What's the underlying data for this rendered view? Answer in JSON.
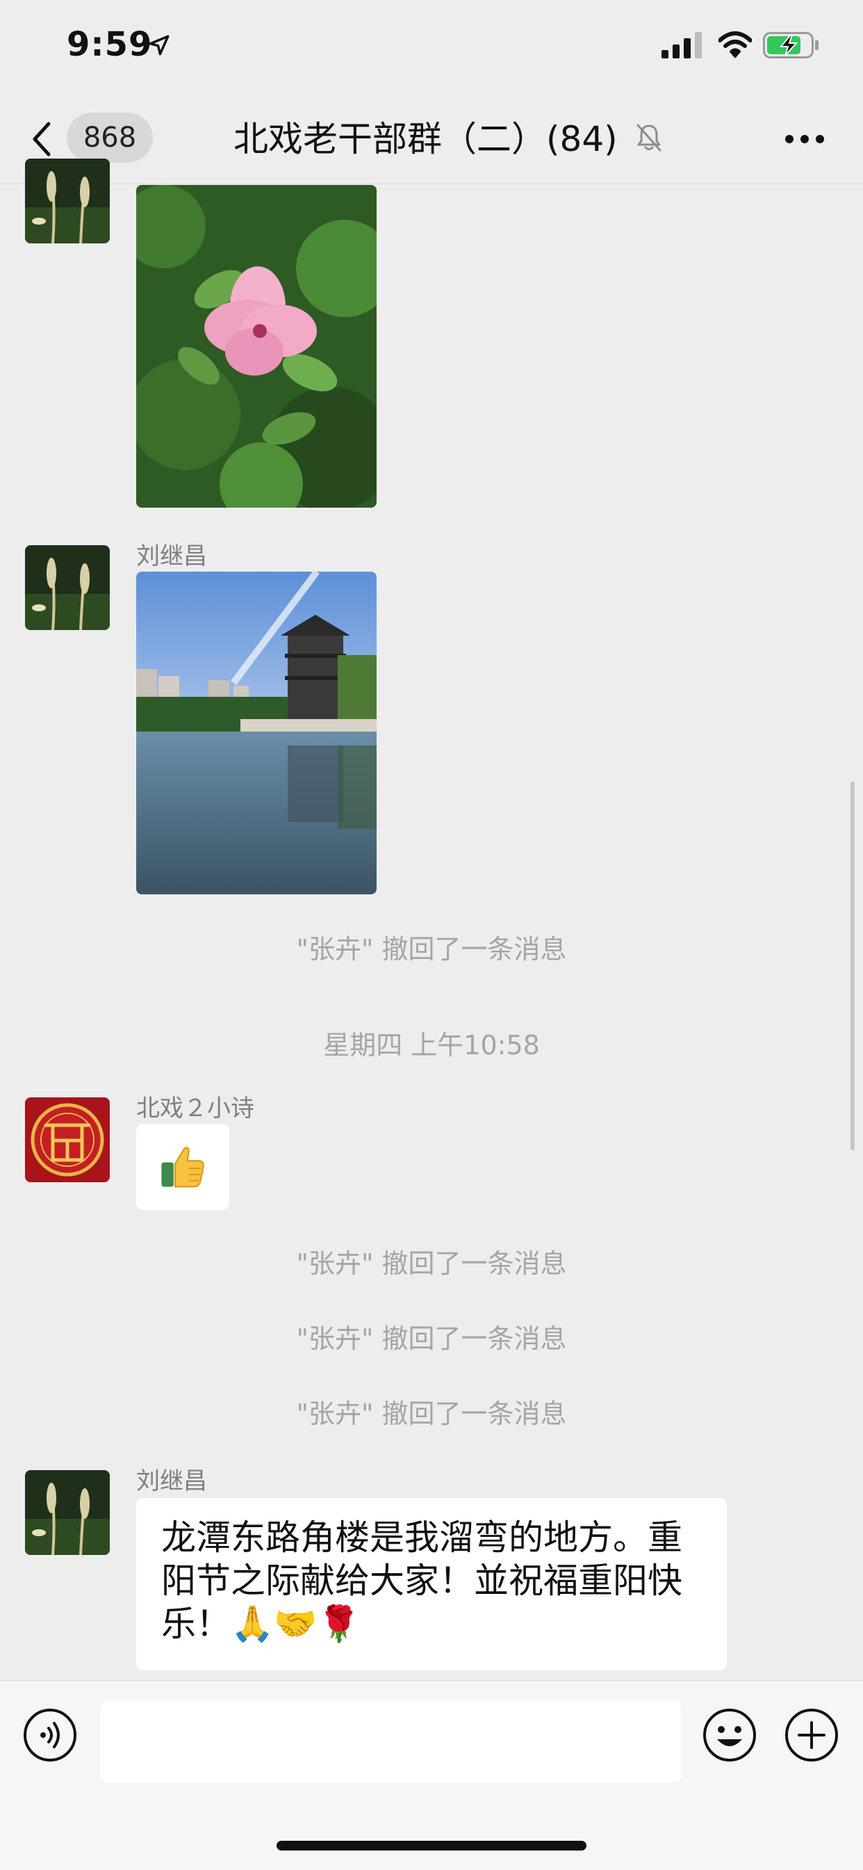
{
  "status_bar": {
    "time": "9:59"
  },
  "nav": {
    "unread_badge": "868",
    "title": "北戏老干部群（二）(84)"
  },
  "messages": {
    "m2_sender": "刘继昌",
    "recall_1": "\"张卉\" 撤回了一条消息",
    "timestamp": "星期四 上午10:58",
    "m3_sender": "北戏２小诗",
    "recall_2": "\"张卉\" 撤回了一条消息",
    "recall_3": "\"张卉\" 撤回了一条消息",
    "recall_4": "\"张卉\" 撤回了一条消息",
    "m4_sender": "刘继昌",
    "m4_line1": "龙潭东路角楼是我溜弯的地方。重",
    "m4_line2": "阳节之际献给大家！並祝福重阳快",
    "m4_line3": "乐！🙏🤝🌹"
  },
  "icons": {
    "back": "chevron-left-icon",
    "mute": "bell-slash-icon",
    "more": "more-icon",
    "voice": "voice-icon",
    "emoji": "emoji-icon",
    "plus": "plus-icon"
  },
  "colors": {
    "background": "#ededed",
    "bubble": "#ffffff",
    "system_text": "#a5a5a5",
    "battery_fill": "#34c759"
  }
}
